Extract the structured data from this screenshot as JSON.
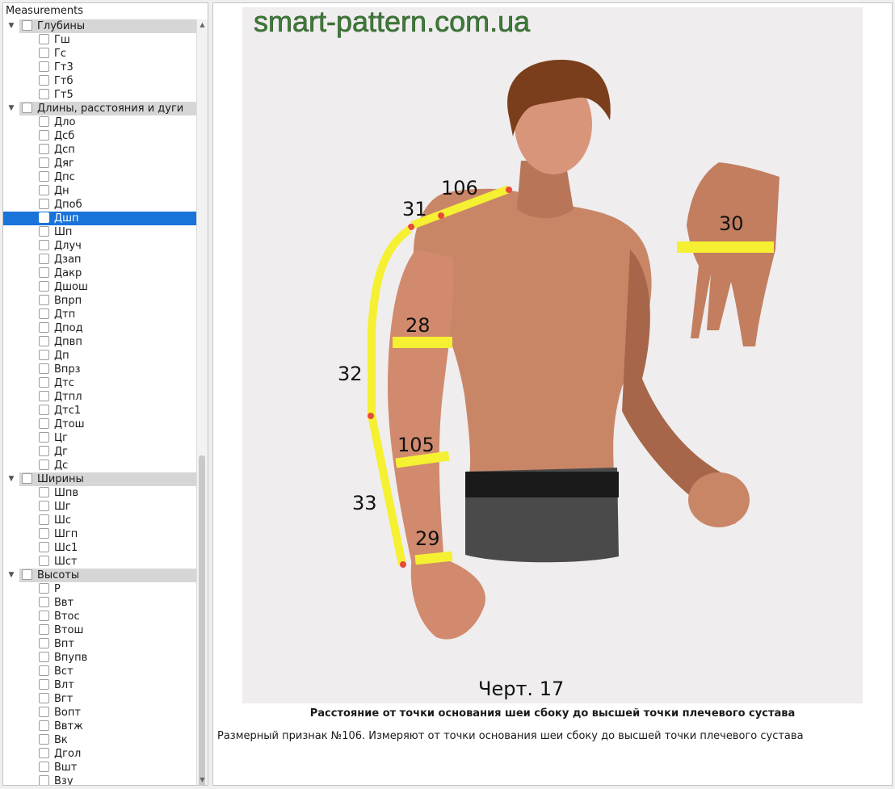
{
  "tree": {
    "header": "Measurements",
    "groups": [
      {
        "name": "Глубины",
        "items": [
          "Гш",
          "Гс",
          "Гт3",
          "Гтб",
          "Гт5"
        ]
      },
      {
        "name": "Длины, расстояния и дуги",
        "items": [
          "Дло",
          "Дсб",
          "Дсп",
          "Дяг",
          "Дпс",
          "Дн",
          "Дпоб",
          "Дшп",
          "Шп",
          "Длуч",
          "Дзап",
          "Дакр",
          "Дшош",
          "Впрп",
          "Дтп",
          "Дпод",
          "Дпвп",
          "Дп",
          "Впрз",
          "Дтс",
          "Дтпл",
          "Дтс1",
          "Дтош",
          "Цг",
          "Дг",
          "Дс"
        ]
      },
      {
        "name": "Ширины",
        "items": [
          "Шпв",
          "Шг",
          "Шс",
          "Шгп",
          "Шс1",
          "Шст"
        ]
      },
      {
        "name": "Высоты",
        "items": [
          "Р",
          "Ввт",
          "Втос",
          "Втош",
          "Впт",
          "Впупв",
          "Вст",
          "Влт",
          "Вгт",
          "Вопт",
          "Ввтж",
          "Вк",
          "Дгол",
          "Вшт",
          "Взу"
        ]
      }
    ],
    "selected": "Дшп"
  },
  "figure": {
    "watermark": "smart-pattern.com.ua",
    "figure_label": "Черт. 17",
    "labels": {
      "m106": "106",
      "m31": "31",
      "m28": "28",
      "m32": "32",
      "m105": "105",
      "m33": "33",
      "m29": "29",
      "m30": "30"
    }
  },
  "caption": {
    "title": "Расстояние от точки основания шеи сбоку до высшей точки плечевого сустава",
    "description": "Размерный признак №106. Измеряют от точки основания шеи сбоку до высшей точки плечевого сустава"
  },
  "colors": {
    "selection": "#1a73d9",
    "tape": "#f5f032",
    "skin": "#d18a6d",
    "watermark": "#3f7a39"
  }
}
